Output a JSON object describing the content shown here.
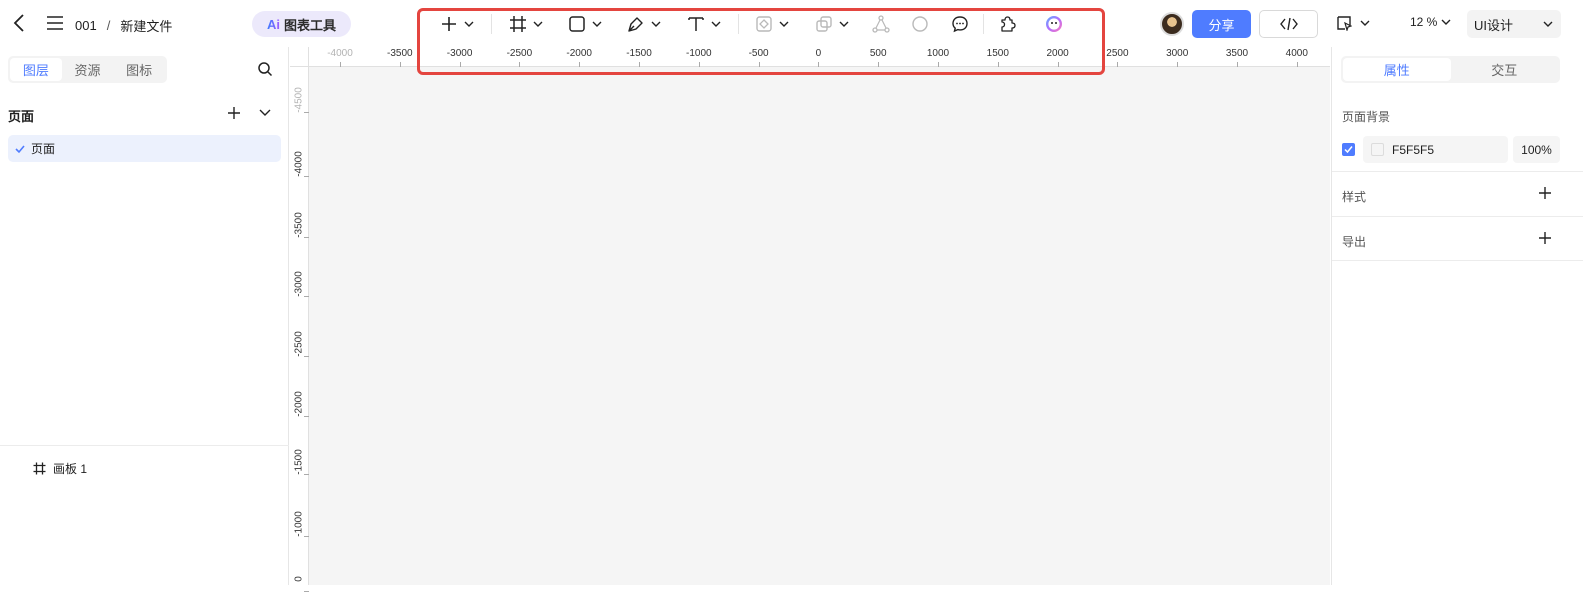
{
  "header": {
    "project": "001",
    "separator": "/",
    "file_name": "新建文件",
    "ai_tool_mark": "Ai",
    "ai_tool_label": "图表工具",
    "share_label": "分享",
    "zoom": "12 %",
    "mode": "UI设计"
  },
  "toolbar": {
    "tools": [
      "add",
      "frame",
      "rectangle",
      "pen",
      "text",
      "component",
      "boolean",
      "vector-network",
      "ellipse",
      "comment",
      "plugin",
      "ai-assistant"
    ]
  },
  "left_panel": {
    "tabs": [
      "图层",
      "资源",
      "图标"
    ],
    "active_tab": "图层",
    "pages_title": "页面",
    "pages": [
      {
        "label": "页面",
        "selected": true
      }
    ],
    "layers": [
      {
        "label": "画板 1"
      }
    ]
  },
  "ruler": {
    "top_ticks": [
      "-4000",
      "-3500",
      "-3000",
      "-2500",
      "-2000",
      "-1500",
      "-1000",
      "-500",
      "0",
      "500",
      "1000",
      "1500",
      "2000",
      "2500",
      "3000",
      "3500",
      "4000"
    ],
    "left_ticks": [
      "-4500",
      "-4000",
      "-3500",
      "-3000",
      "-2500",
      "-2000",
      "-1500",
      "-1000",
      "0"
    ]
  },
  "right_panel": {
    "tabs": [
      "属性",
      "交互"
    ],
    "active_tab": "属性",
    "page_background_label": "页面背景",
    "background_color": "F5F5F5",
    "background_opacity": "100%",
    "style_label": "样式",
    "export_label": "导出"
  },
  "colors": {
    "accent": "#4f7cff",
    "highlight": "#e4453f",
    "canvas_bg": "#f5f5f5"
  }
}
